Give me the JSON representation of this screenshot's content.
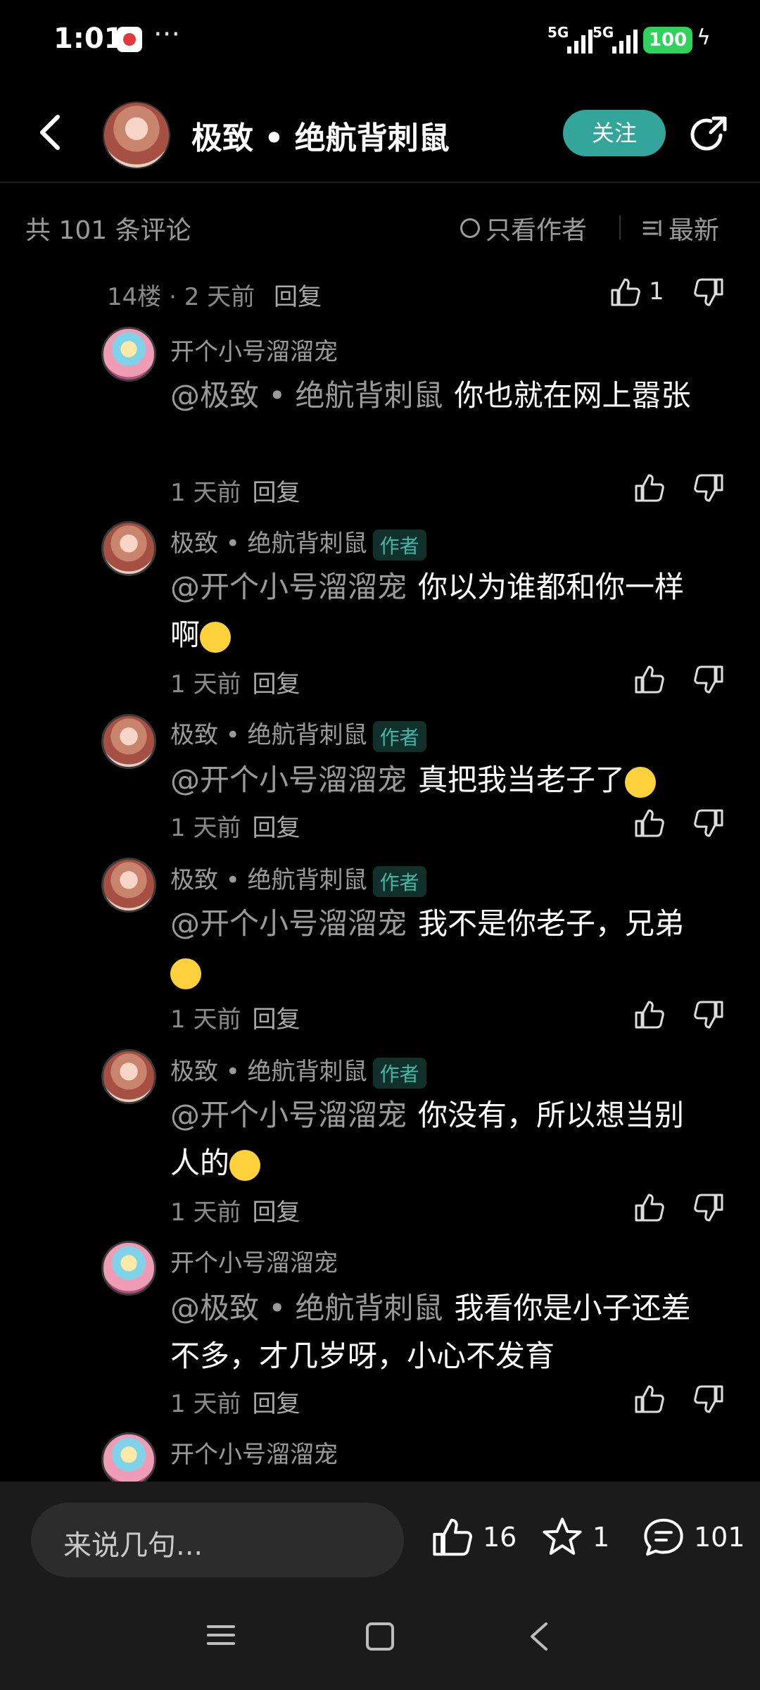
{
  "status_bar": {
    "time": "1:01",
    "more": "···",
    "net1": "5G",
    "net2": "5G",
    "battery": "100"
  },
  "header": {
    "title": "极致 • 绝航背刺鼠",
    "follow": "关注"
  },
  "filter": {
    "count": "共 101 条评论",
    "only_author": "只看作者",
    "latest": "最新"
  },
  "top_comment": {
    "floor": "14楼",
    "time": "· 2 天前",
    "reply": "回复",
    "likes": "1"
  },
  "replies": [
    {
      "name": "开个小号溜溜宠",
      "author": "",
      "mention": "@极致 • 绝航背刺鼠",
      "text": "你也就在网上嚣张",
      "time": "1 天前",
      "reply": "回复"
    },
    {
      "name": "极致 • 绝航背刺鼠",
      "author": "作者",
      "mention": "@开个小号溜溜宠",
      "text": "你以为谁都和你一样啊",
      "time": "1 天前",
      "reply": "回复"
    },
    {
      "name": "极致 • 绝航背刺鼠",
      "author": "作者",
      "mention": "@开个小号溜溜宠",
      "text": "真把我当老子了",
      "time": "1 天前",
      "reply": "回复"
    },
    {
      "name": "极致 • 绝航背刺鼠",
      "author": "作者",
      "mention": "@开个小号溜溜宠",
      "text": "我不是你老子，兄弟",
      "time": "1 天前",
      "reply": "回复"
    },
    {
      "name": "极致 • 绝航背刺鼠",
      "author": "作者",
      "mention": "@开个小号溜溜宠",
      "text": "你没有，所以想当别人的",
      "time": "1 天前",
      "reply": "回复"
    },
    {
      "name": "开个小号溜溜宠",
      "author": "",
      "mention": "@极致 • 绝航背刺鼠",
      "text": "我看你是小子还差不多，才几岁呀，小心不发育",
      "time": "1 天前",
      "reply": "回复"
    },
    {
      "name": "开个小号溜溜宠"
    }
  ],
  "bottom_bar": {
    "placeholder": "来说几句...",
    "likes": "16",
    "favorites": "1",
    "comments": "101"
  },
  "colors": {
    "background": "#000000",
    "accent": "#33a59a",
    "author_tag": "#3fb8a8",
    "battery": "#2fd35b"
  }
}
